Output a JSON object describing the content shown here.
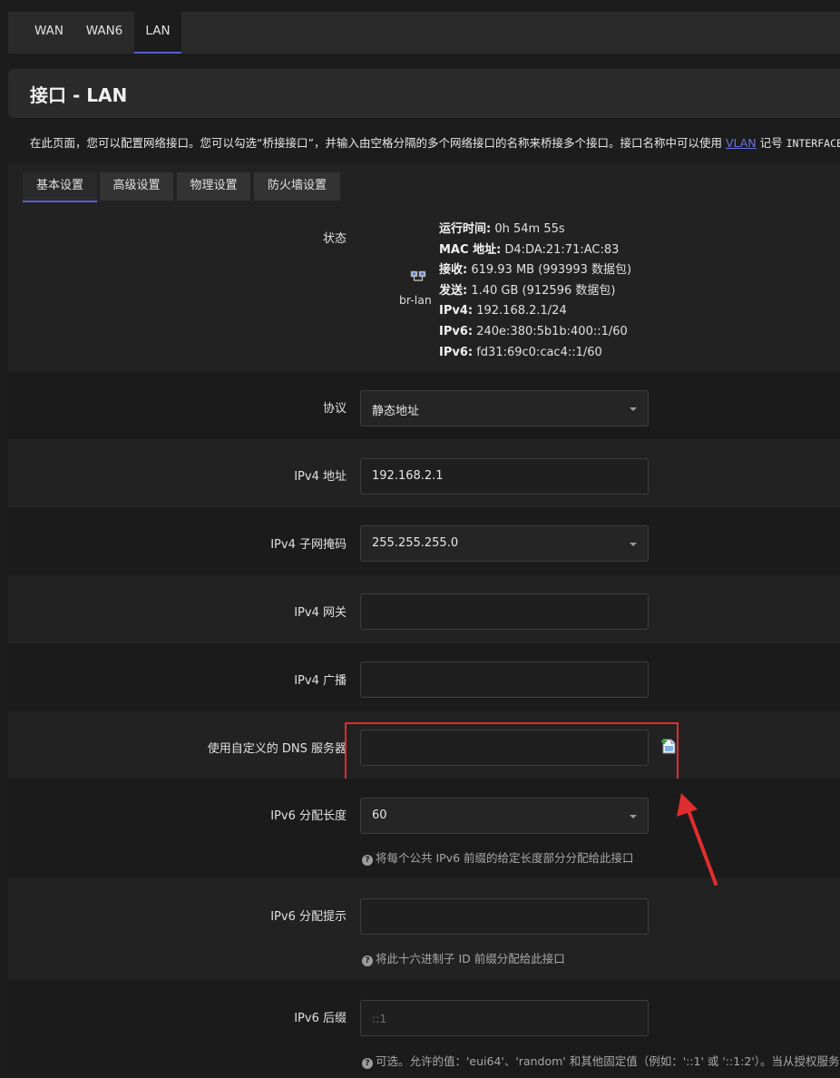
{
  "top_tabs": [
    "WAN",
    "WAN6",
    "LAN"
  ],
  "page_title": "接口 - LAN",
  "description": {
    "before_link": "在此页面，您可以配置网络接口。您可以勾选“桥接接口”，并输入由空格分隔的多个网络接口的名称来桥接多个接口。接口名称中可以使用 ",
    "link": "VLAN",
    "after_link": " 记号 ",
    "mono": "INTERFACE.VLANNR"
  },
  "sub_tabs": [
    "基本设置",
    "高级设置",
    "物理设置",
    "防火墙设置"
  ],
  "status": {
    "label": "状态",
    "iface_name": "br-lan",
    "lines": [
      {
        "key": "运行时间:",
        "value": " 0h 54m 55s"
      },
      {
        "key": "MAC 地址:",
        "value": " D4:DA:21:71:AC:83"
      },
      {
        "key": "接收:",
        "value": " 619.93 MB (993993 数据包)"
      },
      {
        "key": "发送:",
        "value": " 1.40 GB (912596 数据包)"
      },
      {
        "key": "IPv4:",
        "value": " 192.168.2.1/24"
      },
      {
        "key": "IPv6:",
        "value": " 240e:380:5b1b:400::1/60"
      },
      {
        "key": "IPv6:",
        "value": " fd31:69c0:cac4::1/60"
      }
    ]
  },
  "fields": {
    "protocol": {
      "label": "协议",
      "value": "静态地址"
    },
    "ipv4_addr": {
      "label": "IPv4 地址",
      "value": "192.168.2.1"
    },
    "ipv4_netmask": {
      "label": "IPv4 子网掩码",
      "value": "255.255.255.0"
    },
    "ipv4_gateway": {
      "label": "IPv4 网关",
      "value": ""
    },
    "ipv4_broadcast": {
      "label": "IPv4 广播",
      "value": ""
    },
    "dns": {
      "label": "使用自定义的 DNS 服务器",
      "value": ""
    },
    "ip6assign": {
      "label": "IPv6 分配长度",
      "value": "60",
      "hint": "将每个公共 IPv6 前缀的给定长度部分分配给此接口"
    },
    "ip6hint": {
      "label": "IPv6 分配提示",
      "value": "",
      "hint": "将此十六进制子 ID 前缀分配给此接口"
    },
    "ip6ifaceid": {
      "label": "IPv6 后缀",
      "placeholder": "::1",
      "hint": "可选。允许的值：'eui64'、'random' 和其他固定值（例如：'::1' 或 '::1:2'）。当从授权服务器获"
    }
  },
  "colors": {
    "accent": "#5a5fd6",
    "highlight": "#e02d2d"
  }
}
